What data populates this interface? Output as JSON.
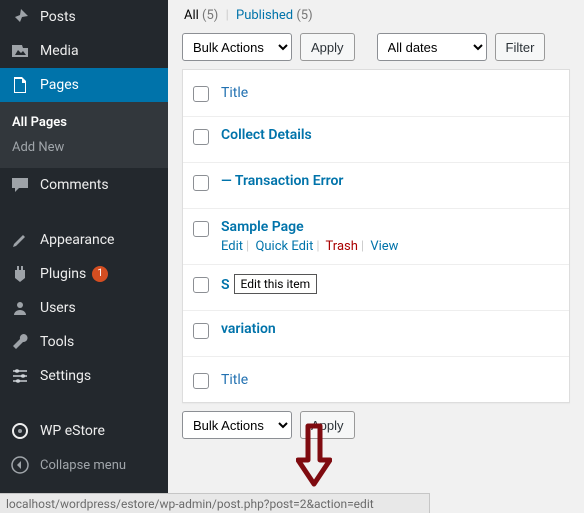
{
  "sidebar": {
    "items": [
      {
        "label": "Posts",
        "icon": "pin"
      },
      {
        "label": "Media",
        "icon": "media"
      },
      {
        "label": "Pages",
        "icon": "pages",
        "current": true
      },
      {
        "label": "Comments",
        "icon": "comment"
      },
      {
        "label": "Appearance",
        "icon": "appearance"
      },
      {
        "label": "Plugins",
        "icon": "plugin",
        "badge": "1"
      },
      {
        "label": "Users",
        "icon": "users"
      },
      {
        "label": "Tools",
        "icon": "tools"
      },
      {
        "label": "Settings",
        "icon": "settings"
      },
      {
        "label": "WP eStore",
        "icon": "store"
      }
    ],
    "submenu": {
      "all_pages": "All Pages",
      "add_new": "Add New"
    },
    "collapse": "Collapse menu"
  },
  "filters": {
    "all_label": "All",
    "all_count": "(5)",
    "published_label": "Published",
    "published_count": "(5)"
  },
  "tablenav_top": {
    "bulk": "Bulk Actions",
    "apply": "Apply",
    "dates": "All dates",
    "filter": "Filter"
  },
  "tablenav_bottom": {
    "bulk": "Bulk Actions",
    "apply": "Apply"
  },
  "table": {
    "column_title": "Title",
    "rows": [
      {
        "title": "Collect Details"
      },
      {
        "title": "— Transaction Error"
      },
      {
        "title": "Sample Page",
        "actions": {
          "edit": "Edit",
          "quick": "Quick Edit",
          "trash": "Trash",
          "view": "View"
        }
      },
      {
        "title": "S",
        "tooltip": "Edit this item"
      },
      {
        "title": "variation"
      }
    ]
  },
  "status_url": "localhost/wordpress/estore/wp-admin/post.php?post=2&action=edit"
}
